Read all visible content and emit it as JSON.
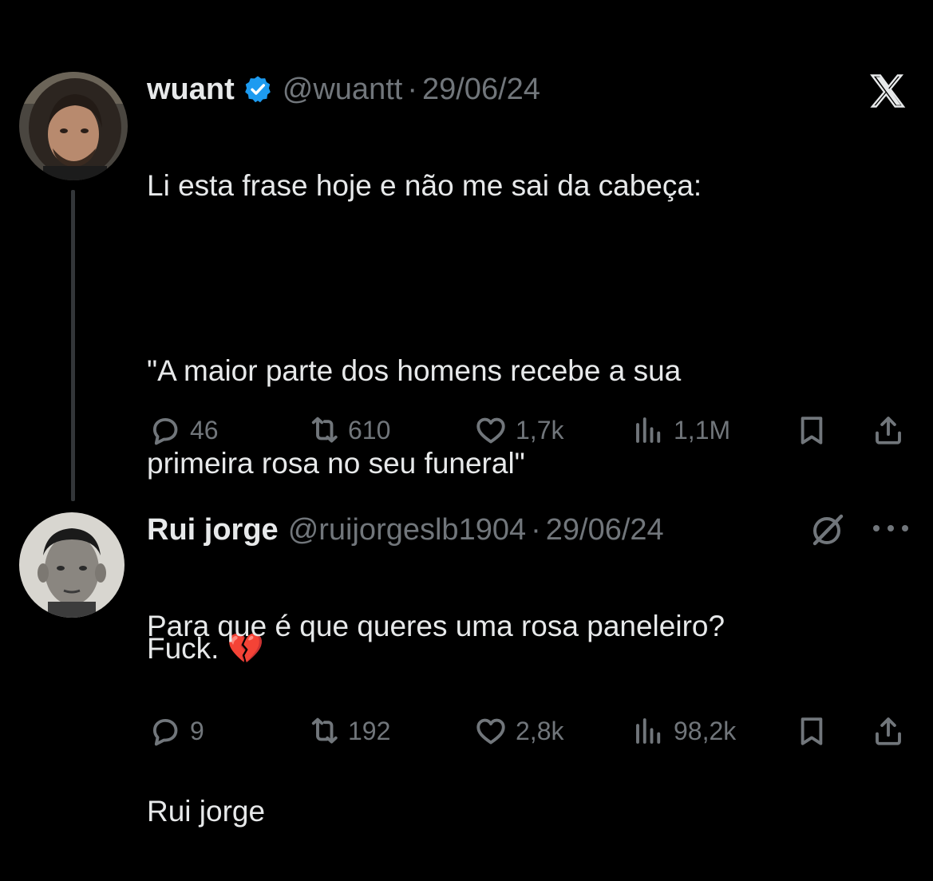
{
  "tweets": [
    {
      "author": {
        "name": "wuant",
        "handle": "@wuantt",
        "verified": true
      },
      "separator": "·",
      "date": "29/06/24",
      "text_lines": [
        "Li esta frase hoje e não me sai da cabeça:",
        "",
        "\"A maior parte dos homens recebe a sua",
        "primeira rosa no seu funeral\"",
        "",
        "Fuck. 💔"
      ],
      "stats": {
        "replies": "46",
        "reposts": "610",
        "likes": "1,7k",
        "views": "1,1M"
      }
    },
    {
      "author": {
        "name": "Rui jorge",
        "handle": "@ruijorgeslb1904",
        "verified": false
      },
      "separator": "·",
      "date": "29/06/24",
      "text_lines": [
        "Para que é que queres uma rosa paneleiro?",
        "",
        "Rui jorge"
      ],
      "stats": {
        "replies": "9",
        "reposts": "192",
        "likes": "2,8k",
        "views": "98,2k"
      }
    }
  ],
  "icons": {
    "brand": "x-logo-icon",
    "verified": "verified-badge-icon",
    "grok": "grok-icon",
    "more": "more-icon",
    "reply": "reply-icon",
    "repost": "repost-icon",
    "like": "like-icon",
    "views": "views-icon",
    "bookmark": "bookmark-icon",
    "share": "share-icon"
  },
  "colors": {
    "background": "#000000",
    "text": "#e7e9ea",
    "muted": "#71767b",
    "verified": "#1d9bf0",
    "thread_line": "#333639"
  }
}
